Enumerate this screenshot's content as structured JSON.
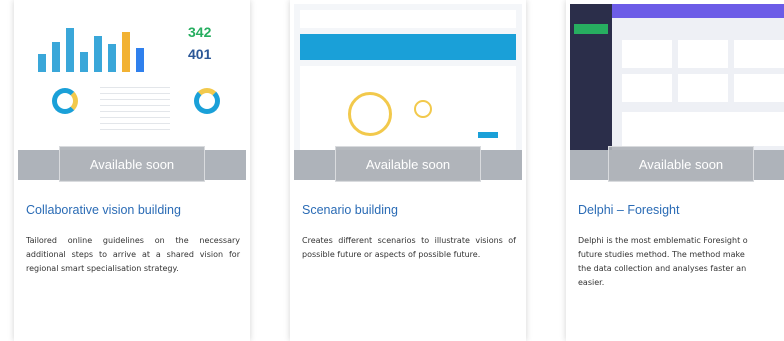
{
  "cards": [
    {
      "badge": "Available soon",
      "title": "Collaborative vision building",
      "description": "Tailored online guidelines on the necessary additional steps to arrive at a shared vision for regional smart specialisation strategy.",
      "thumb_values": [
        "342",
        "401"
      ]
    },
    {
      "badge": "Available soon",
      "title": "Scenario building",
      "description": "Creates different scenarios to illustrate visions of possible future or aspects of possible future."
    },
    {
      "badge": "Available soon",
      "title": "Delphi – Foresight",
      "description_lines": [
        "Delphi is the most emblematic Foresight o",
        "future studies method. The method make",
        "the data collection and analyses faster an",
        "easier."
      ]
    }
  ],
  "colors": {
    "title_blue": "#2a6bb5",
    "badge_gray": "#b0b4ba",
    "banner_blue": "#1aa0d8",
    "dashboard_green": "#27ae60",
    "dashboard_purple": "#6c5ce7"
  }
}
